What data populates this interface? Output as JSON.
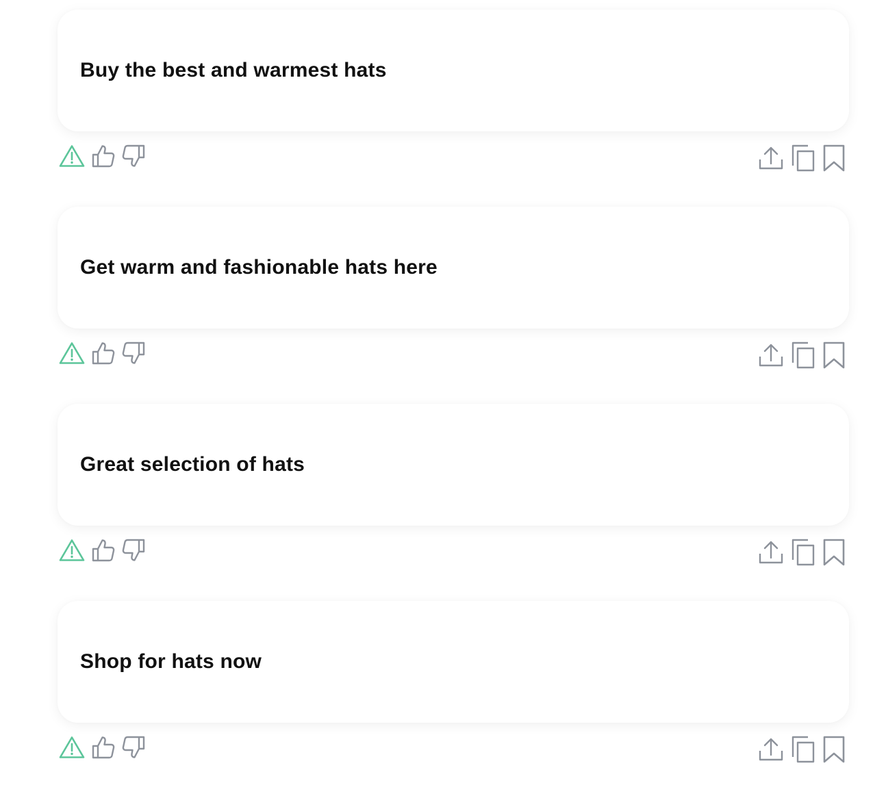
{
  "colors": {
    "warning": "#5cc59a",
    "icon": "#8d929b",
    "text": "#111111"
  },
  "icons": {
    "left": [
      "warning-icon",
      "thumbs-up-icon",
      "thumbs-down-icon"
    ],
    "right": [
      "share-icon",
      "copy-icon",
      "bookmark-icon"
    ]
  },
  "results": [
    {
      "text": "Buy the best and warmest hats"
    },
    {
      "text": "Get warm and fashionable hats here"
    },
    {
      "text": "Great selection of hats"
    },
    {
      "text": "Shop for hats now"
    }
  ]
}
